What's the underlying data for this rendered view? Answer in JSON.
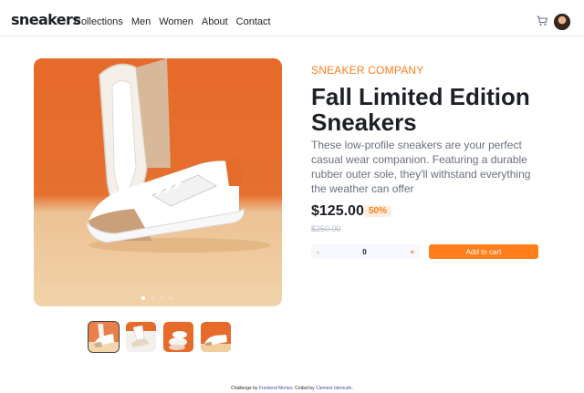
{
  "header": {
    "logo": "sneakers",
    "nav": [
      "Collections",
      "Men",
      "Women",
      "About",
      "Contact"
    ],
    "cart_icon": "cart-icon",
    "avatar_icon": "user-avatar"
  },
  "gallery": {
    "dots_count": 4,
    "active_dot": 0,
    "thumbnails": 4,
    "active_thumbnail": 0
  },
  "product": {
    "company": "SNEAKER COMPANY",
    "title": "Fall Limited Edition Sneakers",
    "description": "These low-profile sneakers are your perfect casual wear companion. Featuring a durable rubber outer sole, they'll withstand everything the weather can offer",
    "price": "$125.00",
    "discount": "50%",
    "original_price": "$250.00",
    "quantity": {
      "minus": "-",
      "value": "0",
      "plus": "+"
    },
    "add_to_cart": "Add to cart"
  },
  "footer": {
    "prefix": "Challenge by ",
    "mentor": "Frontend Mentor",
    "middle": ". Coded by ",
    "author": "Clement Idemudo",
    "suffix": "."
  },
  "colors": {
    "accent": "#ff7d1a",
    "accent_pale": "#ffede0",
    "text_dark": "#1d2026",
    "text_muted": "#68707d"
  }
}
